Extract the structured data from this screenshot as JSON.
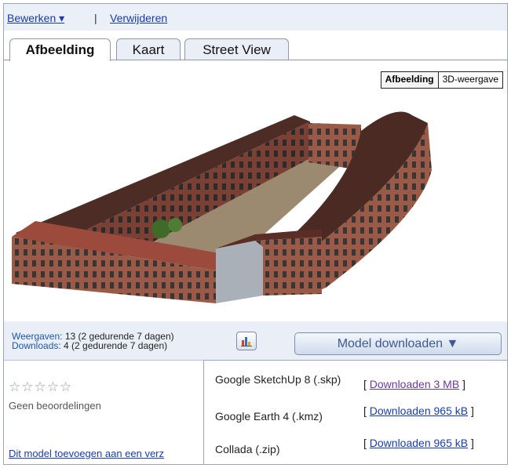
{
  "toolbar": {
    "edit_label": "Bewerken ▾",
    "separator": "|",
    "delete_label": "Verwijderen"
  },
  "tabs": [
    {
      "label": "Afbeelding",
      "active": true
    },
    {
      "label": "Kaart",
      "active": false
    },
    {
      "label": "Street View",
      "active": false
    }
  ],
  "view_toggle": {
    "image_label": "Afbeelding",
    "threed_label": "3D-weergave",
    "selected": "Afbeelding"
  },
  "stats": {
    "views_label": "Weergaven:",
    "views_value": "13 (2 gedurende 7 dagen)",
    "downloads_label": "Downloads:",
    "downloads_value": "4 (2 gedurende 7 dagen)"
  },
  "download_button": {
    "label": "Model downloaden ▼"
  },
  "rating": {
    "stars": "☆☆☆☆☆",
    "no_ratings": "Geen beoordelingen"
  },
  "add_link": "Dit model toevoegen aan een verz",
  "download_menu": [
    {
      "name": "Google SketchUp 8 (.skp)",
      "open": "[",
      "link": "Downloaden 3 MB",
      "close": "]"
    },
    {
      "name": "Google Earth 4 (.kmz)",
      "open": "[",
      "link": "Downloaden 965 kB",
      "close": "]"
    },
    {
      "name": "Collada (.zip)",
      "open": "[",
      "link": "Downloaden 965 kB",
      "close": "]"
    }
  ],
  "colors": {
    "link": "#1a3cab",
    "toolbar_bg": "#ebeff7",
    "roof": "#4a2a22",
    "wall": "#8a4a3a"
  }
}
